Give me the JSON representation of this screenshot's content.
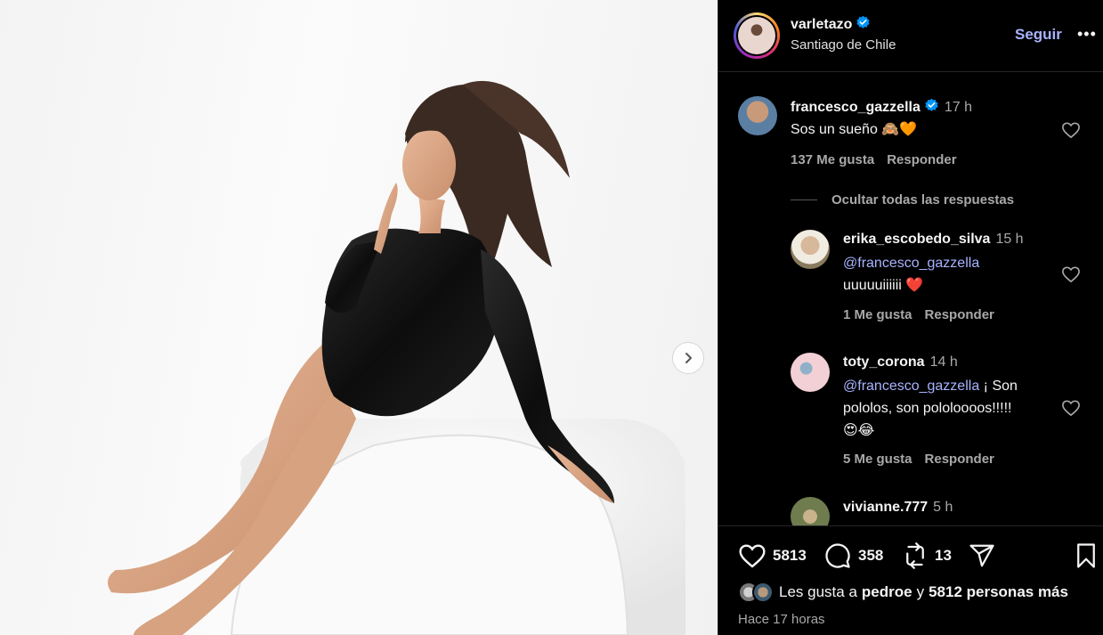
{
  "post": {
    "author": "varletazo",
    "location": "Santiago de Chile",
    "follow_label": "Seguir",
    "more_label": "•••"
  },
  "comments": [
    {
      "user": "francesco_gazzella",
      "verified": true,
      "time": "17 h",
      "text": "Sos un sueño 🙈🧡",
      "likes": "137 Me gusta",
      "reply": "Responder"
    }
  ],
  "hide_replies_label": "Ocultar todas las respuestas",
  "replies": [
    {
      "user": "erika_escobedo_silva",
      "time": "15 h",
      "mention": "@francesco_gazzella",
      "text": "uuuuuiiiiii ❤️",
      "likes": "1 Me gusta",
      "reply": "Responder"
    },
    {
      "user": "toty_corona",
      "time": "14 h",
      "mention": "@francesco_gazzella",
      "text_line1": "¡ Son",
      "text_line2": "pololos, son pololoooos!!!!!",
      "text_line3": "😍😂",
      "likes": "5 Me gusta",
      "reply": "Responder"
    },
    {
      "user": "vivianne.777",
      "time": "5 h"
    }
  ],
  "actions": {
    "like_count": "5813",
    "comment_count": "358",
    "repost_count": "13"
  },
  "likes_summary": {
    "prefix": "Les gusta a",
    "user": "pedroe",
    "middle": "y",
    "others": "5812 personas más"
  },
  "time_ago": "Hace 17 horas",
  "colors": {
    "accent_link": "#a8b3ff",
    "verified_blue": "#0095f6",
    "muted_text": "#a8a8a8"
  }
}
